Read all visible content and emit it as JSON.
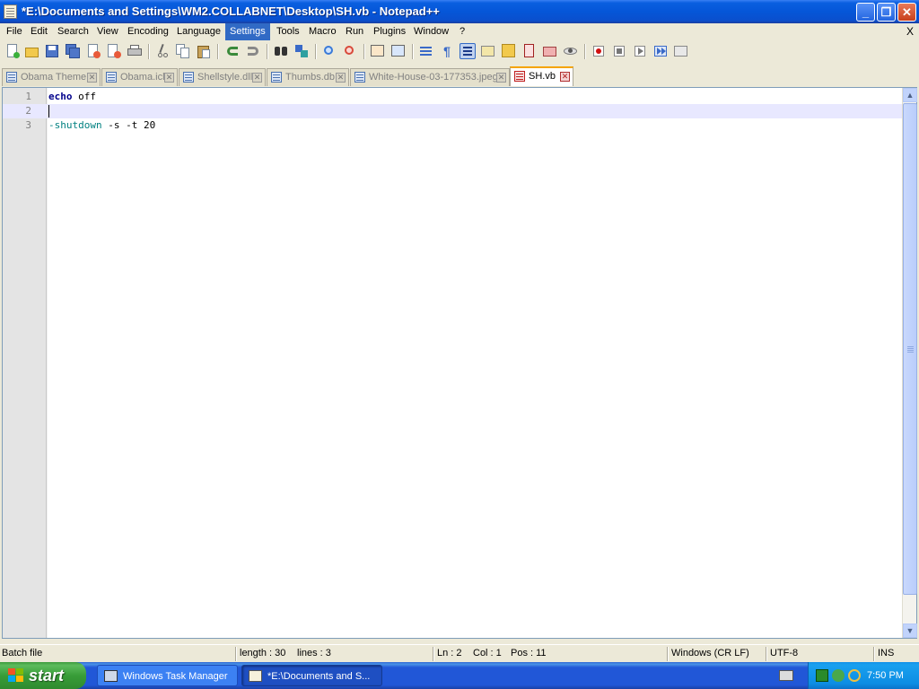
{
  "window": {
    "title": "*E:\\Documents and Settings\\WM2.COLLABNET\\Desktop\\SH.vb - Notepad++",
    "icon": "notepad-icon",
    "controls": [
      "minimize",
      "maximize",
      "close"
    ]
  },
  "menu": {
    "items": [
      "File",
      "Edit",
      "Search",
      "View",
      "Encoding",
      "Language",
      "Settings",
      "Tools",
      "Macro",
      "Run",
      "Plugins",
      "Window",
      "?"
    ],
    "active": "Settings",
    "close_label": "X"
  },
  "toolbar": {
    "icons": [
      "new-file-icon",
      "open-file-icon",
      "save-icon",
      "save-all-icon",
      "close-icon",
      "close-all-icon",
      "print-icon",
      "cut-icon",
      "copy-icon",
      "paste-icon",
      "undo-icon",
      "redo-icon",
      "find-icon",
      "replace-icon",
      "zoom-in-icon",
      "zoom-out-icon",
      "sync-vertical-icon",
      "sync-horizontal-icon",
      "word-wrap-icon",
      "show-all-chars-icon",
      "indent-guide-icon",
      "user-defined-lang-icon",
      "doc-map-icon",
      "function-list-icon",
      "folder-workspace-icon",
      "monitoring-icon",
      "record-macro-icon",
      "stop-macro-icon",
      "play-macro-icon",
      "run-macro-multiple-icon",
      "save-macro-icon"
    ]
  },
  "tabs": [
    {
      "label": "Obama Theme",
      "active": false
    },
    {
      "label": "Obama.icl",
      "active": false
    },
    {
      "label": "Shellstyle.dll",
      "active": false
    },
    {
      "label": "Thumbs.db",
      "active": false
    },
    {
      "label": "White-House-03-177353.jpeg",
      "active": false
    },
    {
      "label": "SH.vb",
      "active": true
    }
  ],
  "editor": {
    "lines": [
      {
        "num": "1",
        "keyword": "echo",
        "rest": " off",
        "dash": "",
        "command": ""
      },
      {
        "num": "2",
        "keyword": "",
        "rest": "",
        "dash": "",
        "command": ""
      },
      {
        "num": "3",
        "keyword": "",
        "rest": " -s -t 20",
        "dash": "-",
        "command": "shutdown"
      }
    ],
    "current_line": 2
  },
  "status": {
    "file_type": "Batch file",
    "length": "length : 30",
    "lines": "lines : 3",
    "ln": "Ln : 2",
    "col": "Col : 1",
    "pos": "Pos : 11",
    "eol": "Windows (CR LF)",
    "encoding": "UTF-8",
    "mode": "INS"
  },
  "taskbar": {
    "start_label": "start",
    "buttons": [
      {
        "label": "Windows Task Manager",
        "icon": "task-manager-icon",
        "active": false
      },
      {
        "label": "*E:\\Documents and S...",
        "icon": "notepad-icon",
        "active": true
      }
    ],
    "clock": "7:50 PM"
  },
  "colors": {
    "keyword": "#00008b",
    "command": "#008080",
    "current_line": "#e8e8ff",
    "active_tab_accent": "#f5a400",
    "menu_highlight": "#316ac5"
  }
}
